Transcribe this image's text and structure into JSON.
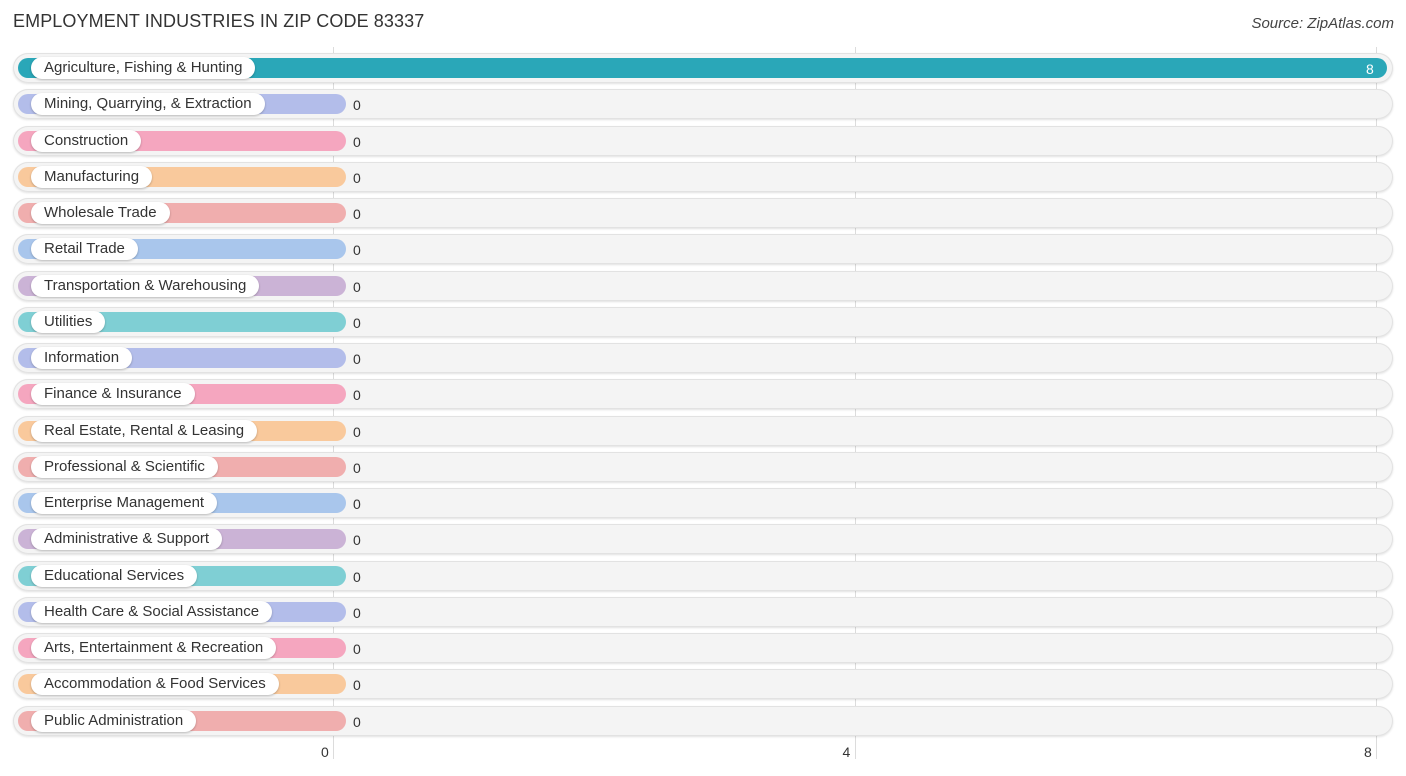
{
  "header": {
    "title": "EMPLOYMENT INDUSTRIES IN ZIP CODE 83337",
    "source": "Source: ZipAtlas.com"
  },
  "chart_data": {
    "type": "bar",
    "orientation": "horizontal",
    "title": "EMPLOYMENT INDUSTRIES IN ZIP CODE 83337",
    "xlabel": "",
    "ylabel": "",
    "xlim": [
      0,
      8
    ],
    "x_ticks": [
      "0",
      "4",
      "8"
    ],
    "grid": true,
    "categories": [
      "Agriculture, Fishing & Hunting",
      "Mining, Quarrying, & Extraction",
      "Construction",
      "Manufacturing",
      "Wholesale Trade",
      "Retail Trade",
      "Transportation & Warehousing",
      "Utilities",
      "Information",
      "Finance & Insurance",
      "Real Estate, Rental & Leasing",
      "Professional & Scientific",
      "Enterprise Management",
      "Administrative & Support",
      "Educational Services",
      "Health Care & Social Assistance",
      "Arts, Entertainment & Recreation",
      "Accommodation & Food Services",
      "Public Administration"
    ],
    "values": [
      8,
      0,
      0,
      0,
      0,
      0,
      0,
      0,
      0,
      0,
      0,
      0,
      0,
      0,
      0,
      0,
      0,
      0,
      0
    ],
    "value_labels": [
      "8",
      "0",
      "0",
      "0",
      "0",
      "0",
      "0",
      "0",
      "0",
      "0",
      "0",
      "0",
      "0",
      "0",
      "0",
      "0",
      "0",
      "0",
      "0"
    ],
    "colors": [
      "#2aa7b8",
      "#b3bdea",
      "#f5a6bf",
      "#f9c99c",
      "#f0aeae",
      "#a9c6ec",
      "#cbb3d6",
      "#7fcfd4",
      "#b3bdea",
      "#f5a6bf",
      "#f9c99c",
      "#f0aeae",
      "#a9c6ec",
      "#cbb3d6",
      "#7fcfd4",
      "#b3bdea",
      "#f5a6bf",
      "#f9c99c",
      "#f0aeae"
    ]
  }
}
